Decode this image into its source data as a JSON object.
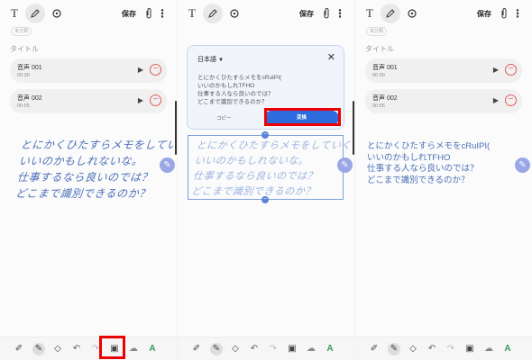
{
  "toolbar": {
    "text_icon": "T",
    "pen_icon": "pen-icon",
    "brush_icon": "brush-icon",
    "save_label": "保存",
    "attach_icon": "paperclip-icon",
    "more_icon": "⋮"
  },
  "category_chip": "未分類",
  "title_placeholder": "タイトル",
  "audio_items": [
    {
      "name": "音声 001",
      "time": "00:30"
    },
    {
      "name": "音声 002",
      "time": "00:55"
    }
  ],
  "handwriting_lines": [
    "とにかくひたすらメモをしていくのは",
    "いいのかもしれないな。",
    "仕事するなら良いのでは？",
    "どこまで識別できるのか？"
  ],
  "recognized_lines": [
    "とにかくひたすらメモをcRuIPI(",
    "いいのかもしれTFHO",
    "仕事する人なら良いのでは？",
    "どこまで識別できるのか？"
  ],
  "dialog": {
    "language": "日本語",
    "close_icon": "close-icon",
    "copy_label": "コピー",
    "convert_label": "変換",
    "preview_lines": [
      "とにかくひたすらメモをcRuIPI(",
      "いいのかもしれTFHO",
      "仕事する人なら良いのでは？",
      "どこまで識別できるのか？"
    ]
  },
  "bottom_tools": [
    "highlighter-icon",
    "pen-tool-icon",
    "eraser-icon",
    "undo-icon",
    "redo-icon",
    "convert-text-icon",
    "shape-icon",
    "ai-icon"
  ],
  "colors": {
    "accent": "#2d6cdf",
    "ink": "#4a6fb8",
    "highlight": "#e00000",
    "delete": "#e35b5b"
  }
}
